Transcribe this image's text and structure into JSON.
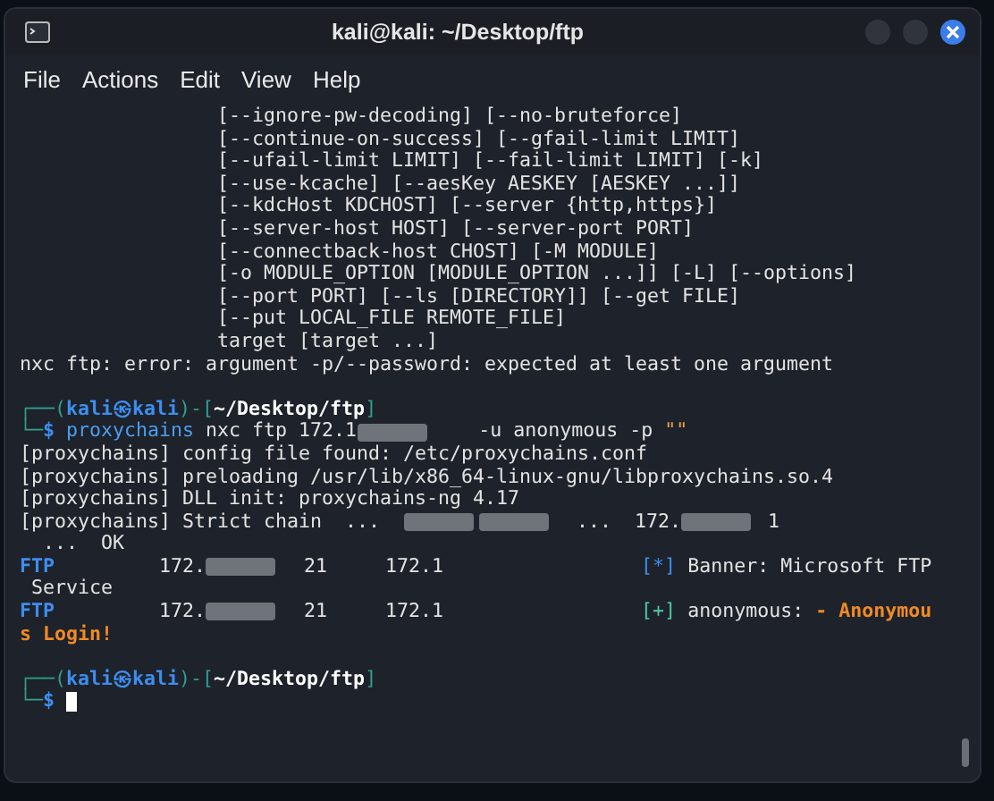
{
  "window": {
    "title": "kali@kali: ~/Desktop/ftp"
  },
  "menu": [
    "File",
    "Actions",
    "Edit",
    "View",
    "Help"
  ],
  "usage_lines": [
    "[--ignore-pw-decoding] [--no-bruteforce]",
    "[--continue-on-success] [--gfail-limit LIMIT]",
    "[--ufail-limit LIMIT] [--fail-limit LIMIT] [-k]",
    "[--use-kcache] [--aesKey AESKEY [AESKEY ...]]",
    "[--kdcHost KDCHOST] [--server {http,https}]",
    "[--server-host HOST] [--server-port PORT]",
    "[--connectback-host CHOST] [-M MODULE]",
    "[-o MODULE_OPTION [MODULE_OPTION ...]] [-L] [--options]",
    "[--port PORT] [--ls [DIRECTORY]] [--get FILE]",
    "[--put LOCAL_FILE REMOTE_FILE]",
    "target [target ...]"
  ],
  "terminal": [
    {
      "kind": "output",
      "segs": [
        {
          "kind": "plain",
          "text": "nxc ftp: error: argument -p/--password: expected at least one argument"
        }
      ]
    },
    {
      "kind": "prompt",
      "segs": [
        {
          "kind": "frame",
          "text": "┌──("
        },
        {
          "kind": "user",
          "text": "kali㉿kali"
        },
        {
          "kind": "frame",
          "text": ")-["
        },
        {
          "kind": "path",
          "text": "~/Desktop/ftp"
        },
        {
          "kind": "frame",
          "text": "]"
        }
      ]
    },
    {
      "kind": "output",
      "segs": [
        {
          "kind": "frame",
          "text": "└─"
        },
        {
          "kind": "user",
          "text": "$ "
        },
        {
          "kind": "command",
          "text": "proxychains"
        },
        {
          "kind": "plain",
          "text": " nxc ftp 172.1"
        },
        {
          "kind": "redacted"
        },
        {
          "kind": "plain",
          "text": "    -u anonymous -p "
        },
        {
          "kind": "quote",
          "text": "\"\""
        }
      ]
    },
    {
      "kind": "output",
      "segs": [
        {
          "kind": "plain",
          "text": "[proxychains] config file found: /etc/proxychains.conf"
        }
      ]
    },
    {
      "kind": "output",
      "segs": [
        {
          "kind": "plain",
          "text": "[proxychains] preloading /usr/lib/x86_64-linux-gnu/libproxychains.so.4"
        }
      ]
    },
    {
      "kind": "output",
      "segs": [
        {
          "kind": "plain",
          "text": "[proxychains] DLL init: proxychains-ng 4.17"
        }
      ]
    },
    {
      "kind": "output",
      "segs": [
        {
          "kind": "plain",
          "text": "[proxychains] Strict chain  ...  "
        },
        {
          "kind": "redacted"
        },
        {
          "kind": "redacted"
        },
        {
          "kind": "plain",
          "text": "  ...  172."
        },
        {
          "kind": "redacted"
        },
        {
          "kind": "plain",
          "text": " 1"
        }
      ]
    },
    {
      "kind": "output",
      "segs": [
        {
          "kind": "plain",
          "text": "  ...  OK"
        }
      ]
    },
    {
      "kind": "output",
      "segs": [
        {
          "kind": "ftp",
          "text": "FTP"
        },
        {
          "kind": "plain",
          "text": "         172."
        },
        {
          "kind": "redacted"
        },
        {
          "kind": "plain",
          "text": "  21     172.1"
        },
        {
          "kind": "gap"
        },
        {
          "kind": "star",
          "text": "[*]"
        },
        {
          "kind": "plain",
          "text": " Banner: Microsoft FTP"
        }
      ]
    },
    {
      "kind": "output",
      "segs": [
        {
          "kind": "plain",
          "text": " Service"
        }
      ]
    },
    {
      "kind": "output",
      "segs": [
        {
          "kind": "ftp",
          "text": "FTP"
        },
        {
          "kind": "plain",
          "text": "         172."
        },
        {
          "kind": "redacted"
        },
        {
          "kind": "plain",
          "text": "  21     172.1"
        },
        {
          "kind": "gap"
        },
        {
          "kind": "plus",
          "text": "[+]"
        },
        {
          "kind": "plain",
          "text": " anonymous: "
        },
        {
          "kind": "success",
          "text": "- Anonymou"
        }
      ]
    },
    {
      "kind": "output",
      "segs": [
        {
          "kind": "success",
          "text": "s Login!"
        }
      ]
    },
    {
      "kind": "prompt",
      "segs": [
        {
          "kind": "frame",
          "text": "┌──("
        },
        {
          "kind": "user",
          "text": "kali㉿kali"
        },
        {
          "kind": "frame",
          "text": ")-["
        },
        {
          "kind": "path",
          "text": "~/Desktop/ftp"
        },
        {
          "kind": "frame",
          "text": "]"
        }
      ]
    },
    {
      "kind": "output",
      "segs": [
        {
          "kind": "frame",
          "text": "└─"
        },
        {
          "kind": "user",
          "text": "$ "
        },
        {
          "kind": "cursor"
        }
      ]
    }
  ]
}
